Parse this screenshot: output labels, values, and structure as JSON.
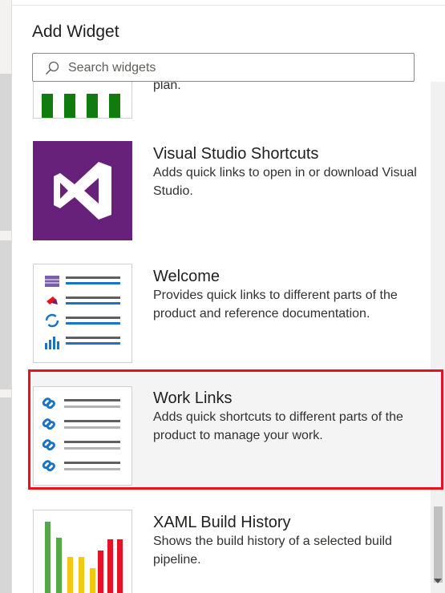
{
  "panel": {
    "title": "Add Widget",
    "search": {
      "placeholder": "Search widgets",
      "value": ""
    }
  },
  "widgets": [
    {
      "name": "",
      "description": "plan.",
      "icon": "green-bars-thumbnail"
    },
    {
      "name": "Visual Studio Shortcuts",
      "description": "Adds quick links to open in or download Visual Studio.",
      "icon": "visual-studio-logo"
    },
    {
      "name": "Welcome",
      "description": "Provides quick links to different parts of the product and reference documentation.",
      "icon": "welcome-links-thumbnail"
    },
    {
      "name": "Work Links",
      "description": "Adds quick shortcuts to different parts of the product to manage your work.",
      "icon": "work-links-thumbnail",
      "selected": true
    },
    {
      "name": "XAML Build History",
      "description": "Shows the build history of a selected build pipeline.",
      "icon": "build-history-thumbnail"
    }
  ],
  "colors": {
    "accent_selection": "#e8111c",
    "vs_purple": "#68217a",
    "green": "#107c10",
    "link_blue": "#1a73c8",
    "build_red": "#e81123",
    "build_yellow": "#f2c811",
    "build_green": "#57a64a"
  }
}
